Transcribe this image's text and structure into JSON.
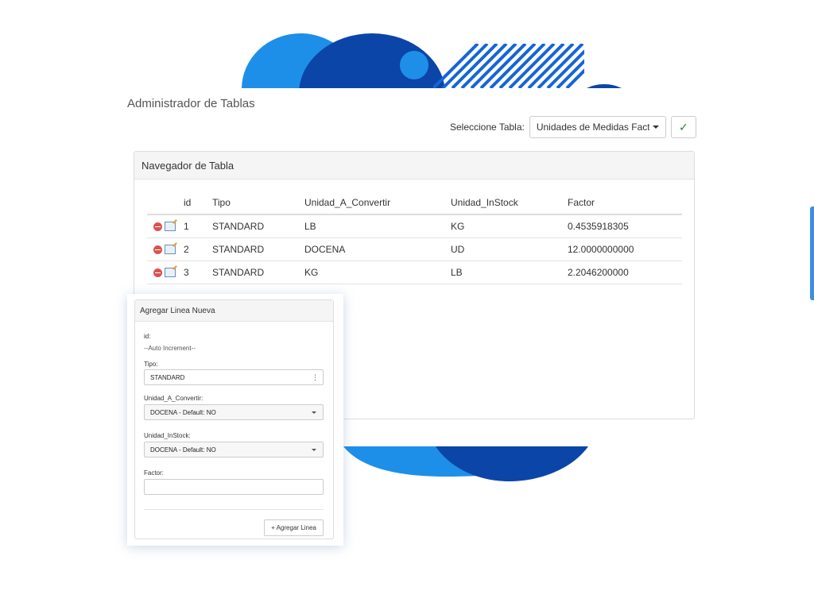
{
  "colors": {
    "blue_light": "#1e8fe8",
    "blue_dark": "#0b45a8",
    "check_green": "#2e7d32",
    "delete_red": "#d9534f"
  },
  "app": {
    "title": "Administrador de Tablas"
  },
  "selector": {
    "label": "Seleccione Tabla:",
    "selected": "Unidades de Medidas Factore",
    "confirm_icon": "check-icon"
  },
  "navigator": {
    "title": "Navegador de Tabla",
    "columns": [
      "id",
      "Tipo",
      "Unidad_A_Convertir",
      "Unidad_InStock",
      "Factor"
    ],
    "rows": [
      {
        "id": "1",
        "tipo": "STANDARD",
        "unidad_a_convertir": "LB",
        "unidad_instock": "KG",
        "factor": "0.4535918305"
      },
      {
        "id": "2",
        "tipo": "STANDARD",
        "unidad_a_convertir": "DOCENA",
        "unidad_instock": "UD",
        "factor": "12.0000000000"
      },
      {
        "id": "3",
        "tipo": "STANDARD",
        "unidad_a_convertir": "KG",
        "unidad_instock": "LB",
        "factor": "2.2046200000"
      }
    ]
  },
  "form": {
    "title": "Agregar Linea Nueva",
    "id_label": "id:",
    "id_value": "--Auto Increment--",
    "tipo_label": "Tipo:",
    "tipo_value": "STANDARD",
    "uac_label": "Unidad_A_Convertir:",
    "uac_value": "DOCENA - Default: NO",
    "uis_label": "Unidad_InStock:",
    "uis_value": "DOCENA - Default: NO",
    "factor_label": "Factor:",
    "factor_value": "",
    "add_button": "+ Agregar Linea"
  }
}
